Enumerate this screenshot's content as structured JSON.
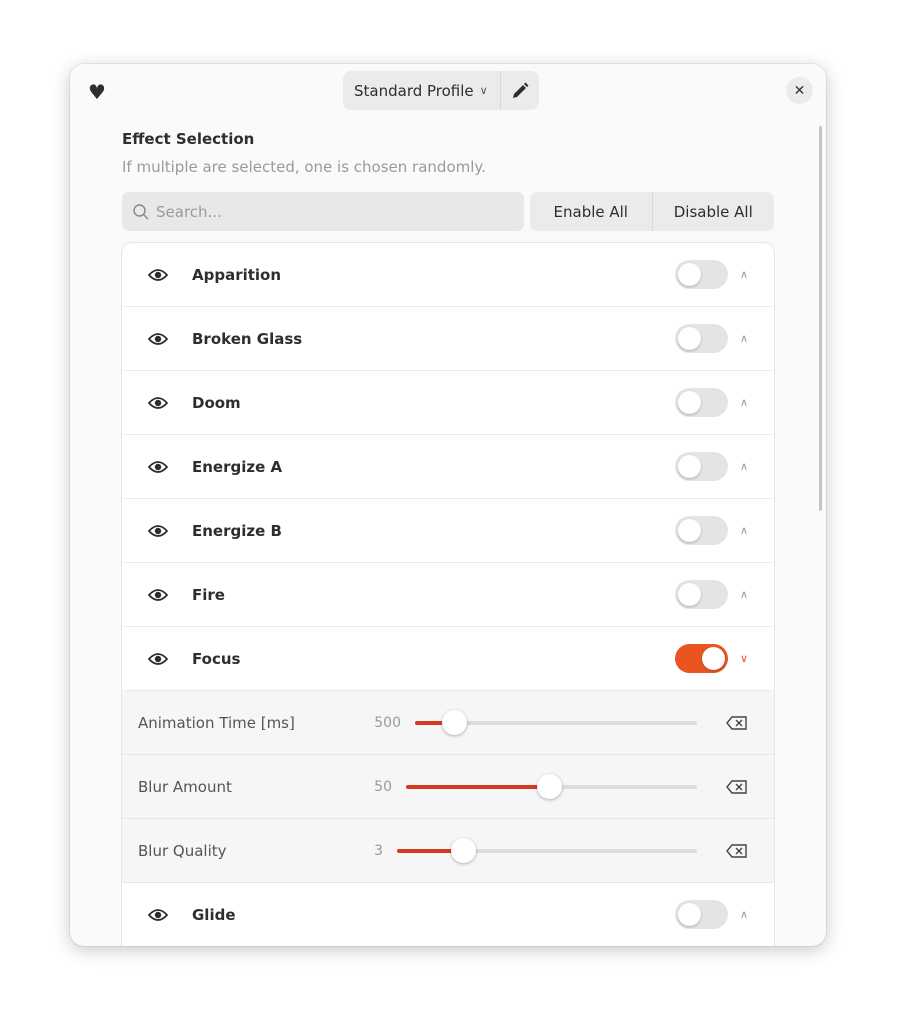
{
  "header": {
    "favorite_icon": "heart-icon",
    "profile": "Standard Profile",
    "edit_icon": "pencil-icon",
    "close_icon": "close-icon"
  },
  "section": {
    "title": "Effect Selection",
    "subtitle": "If multiple are selected, one is chosen randomly."
  },
  "search": {
    "placeholder": "Search...",
    "value": ""
  },
  "actions": {
    "enable_all": "Enable All",
    "disable_all": "Disable All"
  },
  "accent": "#e95420",
  "effects_before": [
    {
      "name": "Apparition",
      "enabled": false
    },
    {
      "name": "Broken Glass",
      "enabled": false
    },
    {
      "name": "Doom",
      "enabled": false
    },
    {
      "name": "Energize A",
      "enabled": false
    },
    {
      "name": "Energize B",
      "enabled": false
    },
    {
      "name": "Fire",
      "enabled": false
    }
  ],
  "focus": {
    "name": "Focus",
    "enabled": true,
    "expanded": true,
    "settings": [
      {
        "label": "Animation Time [ms]",
        "value": "500",
        "fraction": 0.14
      },
      {
        "label": "Blur Amount",
        "value": "50",
        "fraction": 0.49
      },
      {
        "label": "Blur Quality",
        "value": "3",
        "fraction": 0.22
      }
    ]
  },
  "effects_after": [
    {
      "name": "Glide",
      "enabled": false
    }
  ]
}
